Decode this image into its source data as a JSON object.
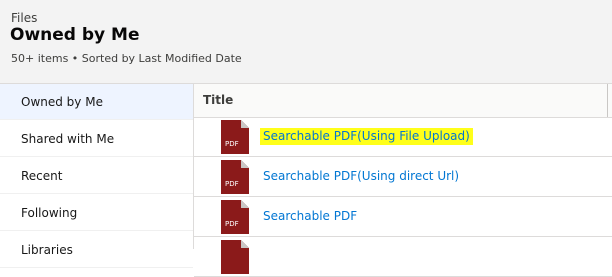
{
  "header": {
    "breadcrumb": "Files",
    "title": "Owned by Me",
    "meta": "50+ items • Sorted by Last Modified Date"
  },
  "sidebar": {
    "items": [
      {
        "label": "Owned by Me",
        "active": true
      },
      {
        "label": "Shared with Me"
      },
      {
        "label": "Recent"
      },
      {
        "label": "Following"
      },
      {
        "label": "Libraries"
      }
    ]
  },
  "table": {
    "column_title": "Title",
    "rows": [
      {
        "title": "Searchable PDF(Using File Upload)",
        "icon": "pdf-file-icon",
        "highlighted": true
      },
      {
        "title": "Searchable PDF(Using direct Url)",
        "icon": "pdf-file-icon"
      },
      {
        "title": "Searchable PDF",
        "icon": "pdf-file-icon"
      },
      {
        "title": "",
        "icon": "pdf-file-icon"
      }
    ],
    "icon_label": "PDF"
  },
  "colors": {
    "link": "#0176d3",
    "highlight": "#ffff1a",
    "pdf_icon": "#8b1a1a",
    "active_nav": "#eef4ff"
  }
}
